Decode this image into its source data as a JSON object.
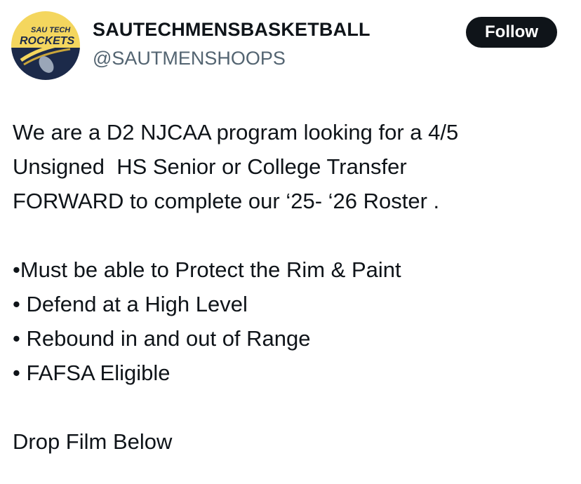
{
  "author": {
    "display_name": "SAUTECHMENSBASKETBALL",
    "handle": "@SAUTMENSHOOPS",
    "avatar": {
      "logo_text_top": "SAU TECH",
      "logo_text_main": "ROCKETS",
      "colors": {
        "top": "#f4d65e",
        "bottom": "#1c2a4a",
        "logo_text": "#1c2a4a"
      }
    }
  },
  "follow_button": {
    "label": "Follow"
  },
  "tweet": {
    "intro_lines": [
      "We are a D2 NJCAA program looking for a 4/5",
      "Unsigned  HS Senior or College Transfer",
      "FORWARD to complete our ‘25- ‘26 Roster ."
    ],
    "requirements": [
      "•Must be able to Protect the Rim & Paint",
      "• Defend at a High Level",
      "• Rebound in and out of Range",
      "• FAFSA Eligible"
    ],
    "closing": "Drop Film Below"
  },
  "colors": {
    "text_primary": "#0f1419",
    "text_secondary": "#536471",
    "button_bg": "#0f1419",
    "button_text": "#ffffff"
  }
}
